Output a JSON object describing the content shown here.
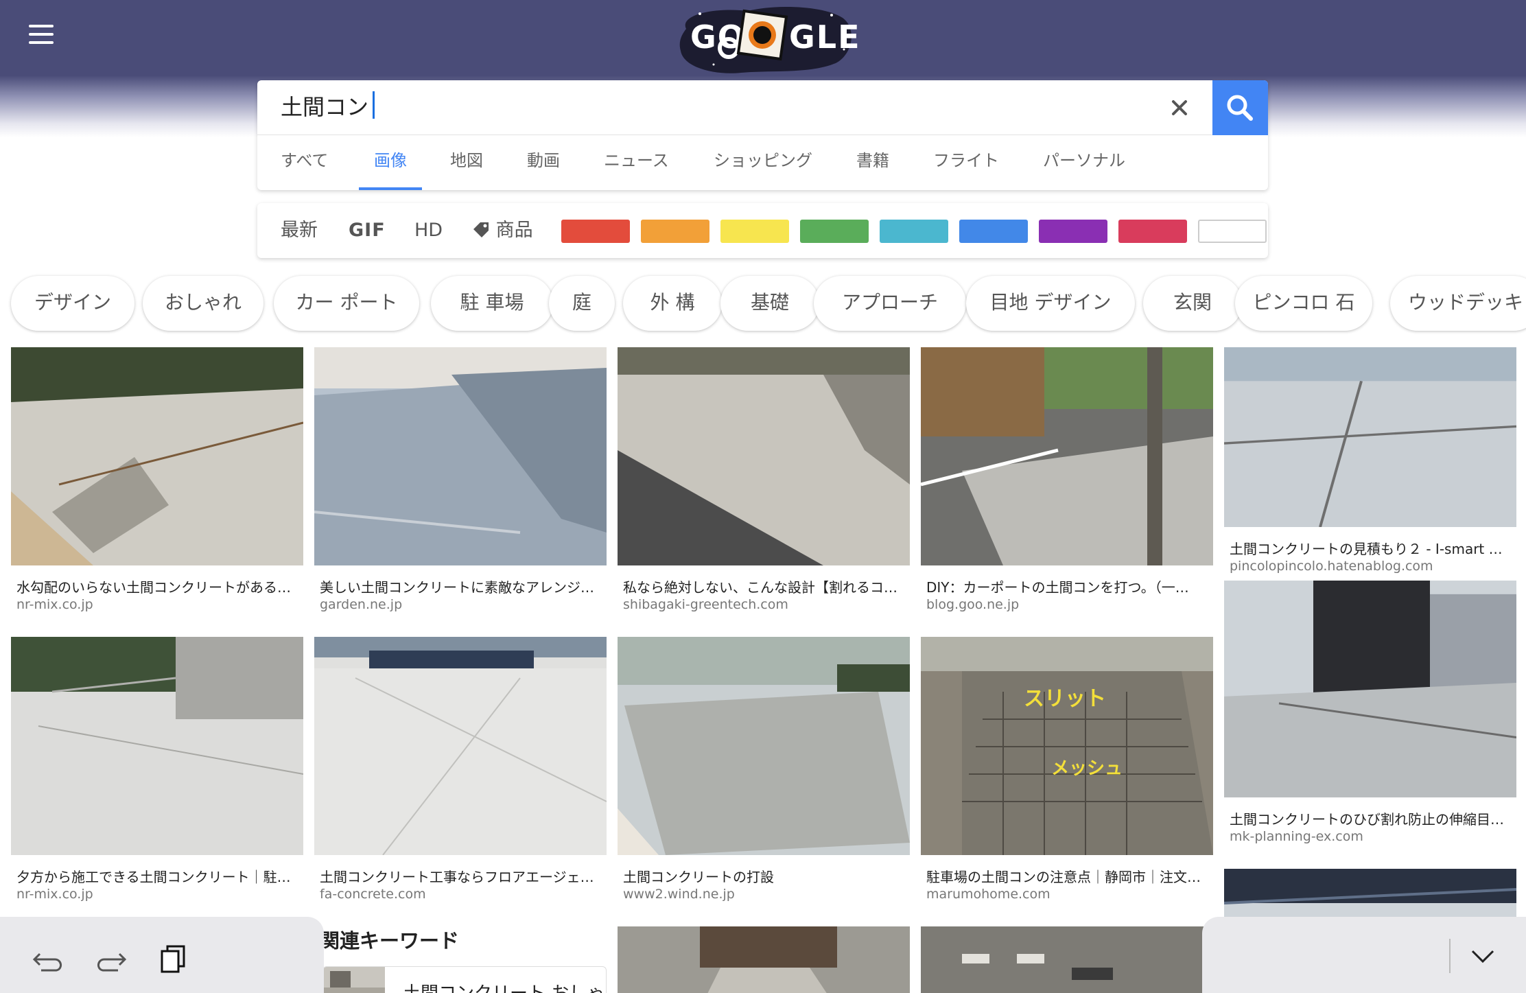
{
  "search": {
    "query": "土間コン"
  },
  "tabs": [
    {
      "label": "すべて"
    },
    {
      "label": "画像"
    },
    {
      "label": "地図"
    },
    {
      "label": "動画"
    },
    {
      "label": "ニュース"
    },
    {
      "label": "ショッピング"
    },
    {
      "label": "書籍"
    },
    {
      "label": "フライト"
    },
    {
      "label": "パーソナル"
    }
  ],
  "active_tab": "画像",
  "filters": {
    "latest": "最新",
    "gif": "GIF",
    "hd": "HD",
    "product": "商品",
    "colors": [
      "#e34c3c",
      "#f2a038",
      "#f7e54f",
      "#5aad5a",
      "#4bb7cf",
      "#4288e8",
      "#8a2fb3",
      "#d93c5c",
      "#ffffff"
    ]
  },
  "chips": [
    {
      "label": "デザイン"
    },
    {
      "label": "おしゃれ"
    },
    {
      "label": "カー ポート"
    },
    {
      "label": "駐 車場"
    },
    {
      "label": "庭"
    },
    {
      "label": "外 構"
    },
    {
      "label": "基礎"
    },
    {
      "label": "アプローチ"
    },
    {
      "label": "目地 デザイン"
    },
    {
      "label": "玄関"
    },
    {
      "label": "ピンコロ 石"
    },
    {
      "label": "ウッドデッキ"
    }
  ],
  "results": [
    {
      "title": "水勾配のいらない土間コンクリートがある…",
      "site": "nr-mix.co.jp"
    },
    {
      "title": "美しい土間コンクリートに素敵なアレンジ…",
      "site": "garden.ne.jp"
    },
    {
      "title": "私なら絶対しない、こんな設計【割れるコ…",
      "site": "shibagaki-greentech.com"
    },
    {
      "title": "DIY：カーポートの土間コンを打つ。（一…",
      "site": "blog.goo.ne.jp"
    },
    {
      "title": "土間コンクリートの見積もり２ - I-smart …",
      "site": "pincolopincolo.hatenablog.com"
    },
    {
      "title": "夕方から施工できる土間コンクリート｜駐…",
      "site": "nr-mix.co.jp"
    },
    {
      "title": "土間コンクリート工事ならフロアエージェ…",
      "site": "fa-concrete.com"
    },
    {
      "title": "土間コンクリートの打設",
      "site": "www2.wind.ne.jp"
    },
    {
      "title": "駐車場の土間コンの注意点｜静岡市｜注文…",
      "site": "marumohome.com"
    },
    {
      "title": "土間コンクリートのひび割れ防止の伸縮目…",
      "site": "mk-planning-ex.com"
    }
  ],
  "image_text": {
    "slit": "スリット",
    "mesh": "メッシュ"
  },
  "related": {
    "title": "関連キーワード",
    "item": "土間コンクリート おしゃ"
  }
}
